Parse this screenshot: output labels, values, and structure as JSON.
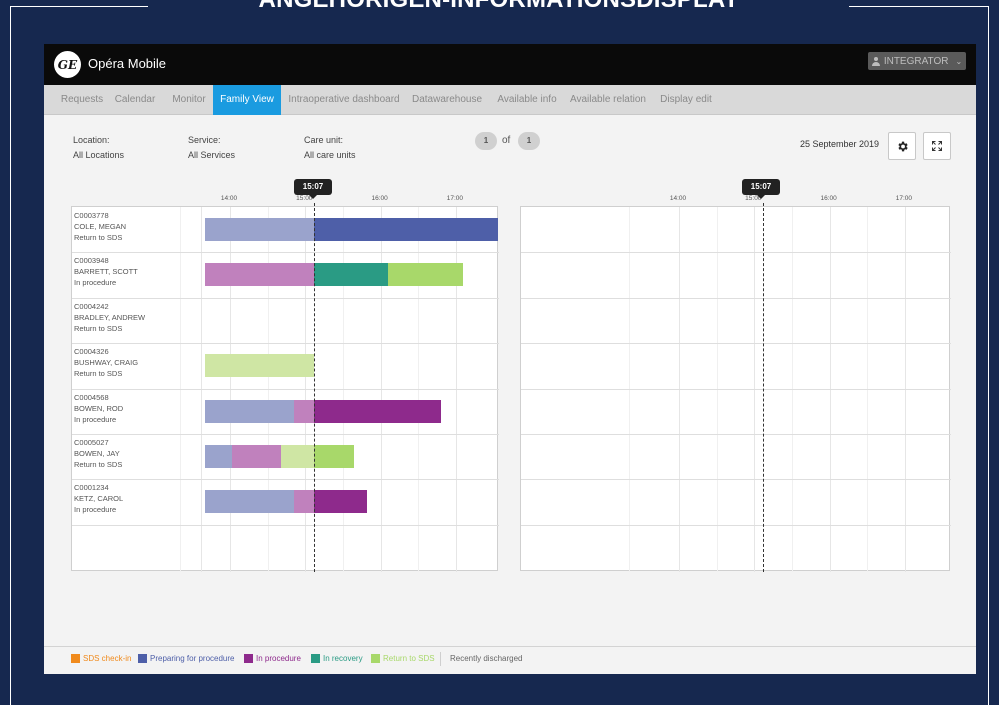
{
  "banner": {
    "title": "ANGEHÖRIGEN-INFORMATIONSDISPLAY"
  },
  "app": {
    "logo_text": "GE",
    "name": "Opéra Mobile",
    "user_button_label": "INTEGRATOR"
  },
  "nav": {
    "tabs": [
      {
        "label": "Requests",
        "active": false
      },
      {
        "label": "Calendar",
        "active": false
      },
      {
        "label": "Monitor",
        "active": false
      },
      {
        "label": "Family View",
        "active": true
      },
      {
        "label": "Intraoperative dashboard",
        "active": false
      },
      {
        "label": "Datawarehouse",
        "active": false
      },
      {
        "label": "Available info",
        "active": false
      },
      {
        "label": "Available relation",
        "active": false
      },
      {
        "label": "Display edit",
        "active": false
      }
    ]
  },
  "filters": {
    "location_label": "Location:",
    "location_value": "All Locations",
    "service_label": "Service:",
    "service_value": "All Services",
    "care_unit_label": "Care unit:",
    "care_unit_value": "All care units"
  },
  "pager": {
    "current": "1",
    "of_label": "of",
    "total": "1"
  },
  "date": "25 September 2019",
  "timeline": {
    "ticks": [
      "14:00",
      "15:00",
      "16:00",
      "17:00"
    ],
    "now_label": "15:07",
    "now_time": 15.117
  },
  "status_colors": {
    "sds_checkin": "#f08a1c",
    "preparing": "#4e5fa8",
    "preparing_light": "#9aa3cc",
    "in_procedure": "#8e2a8c",
    "in_procedure_light": "#c081bd",
    "in_recovery": "#2a9b84",
    "return_to_sds": "#a8d86a",
    "return_to_sds_light": "#cfe6a4"
  },
  "patients": [
    {
      "id": "C0003778",
      "name": "COLE, MEGAN",
      "status": "Return to SDS",
      "segments": [
        {
          "start": 13.667,
          "end": 15.117,
          "color": "#9aa3cc"
        },
        {
          "start": 15.117,
          "end": 17.6,
          "color": "#4e5fa8"
        }
      ]
    },
    {
      "id": "C0003948",
      "name": "BARRETT, SCOTT",
      "status": "In procedure",
      "segments": [
        {
          "start": 13.667,
          "end": 15.117,
          "color": "#c081bd"
        },
        {
          "start": 15.117,
          "end": 16.1,
          "color": "#2a9b84"
        },
        {
          "start": 16.1,
          "end": 17.1,
          "color": "#a8d86a"
        }
      ]
    },
    {
      "id": "C0004242",
      "name": "BRADLEY, ANDREW",
      "status": "Return to SDS",
      "segments": []
    },
    {
      "id": "C0004326",
      "name": "BUSHWAY, CRAIG",
      "status": "Return to SDS",
      "segments": [
        {
          "start": 13.667,
          "end": 15.117,
          "color": "#cfe6a4"
        }
      ]
    },
    {
      "id": "C0004568",
      "name": "BOWEN, ROD",
      "status": "In procedure",
      "segments": [
        {
          "start": 13.667,
          "end": 14.85,
          "color": "#9aa3cc"
        },
        {
          "start": 14.85,
          "end": 15.117,
          "color": "#c081bd"
        },
        {
          "start": 15.117,
          "end": 16.8,
          "color": "#8e2a8c"
        }
      ]
    },
    {
      "id": "C0005027",
      "name": "BOWEN, JAY",
      "status": "Return to SDS",
      "segments": [
        {
          "start": 13.667,
          "end": 14.033,
          "color": "#9aa3cc"
        },
        {
          "start": 14.033,
          "end": 14.683,
          "color": "#c081bd"
        },
        {
          "start": 14.683,
          "end": 15.117,
          "color": "#cfe6a4"
        },
        {
          "start": 15.117,
          "end": 15.65,
          "color": "#a8d86a"
        }
      ]
    },
    {
      "id": "C0001234",
      "name": "KETZ, CAROL",
      "status": "In procedure",
      "segments": [
        {
          "start": 13.667,
          "end": 14.85,
          "color": "#9aa3cc"
        },
        {
          "start": 14.85,
          "end": 15.117,
          "color": "#c081bd"
        },
        {
          "start": 15.117,
          "end": 15.817,
          "color": "#8e2a8c"
        }
      ]
    }
  ],
  "legend": [
    {
      "label": "SDS check-in",
      "color": "#f08a1c"
    },
    {
      "label": "Preparing for procedure",
      "color": "#4e5fa8"
    },
    {
      "label": "In procedure",
      "color": "#8e2a8c"
    },
    {
      "label": "In recovery",
      "color": "#2a9b84"
    },
    {
      "label": "Return to SDS",
      "color": "#a8d86a"
    }
  ],
  "legend_discharged": "Recently discharged"
}
